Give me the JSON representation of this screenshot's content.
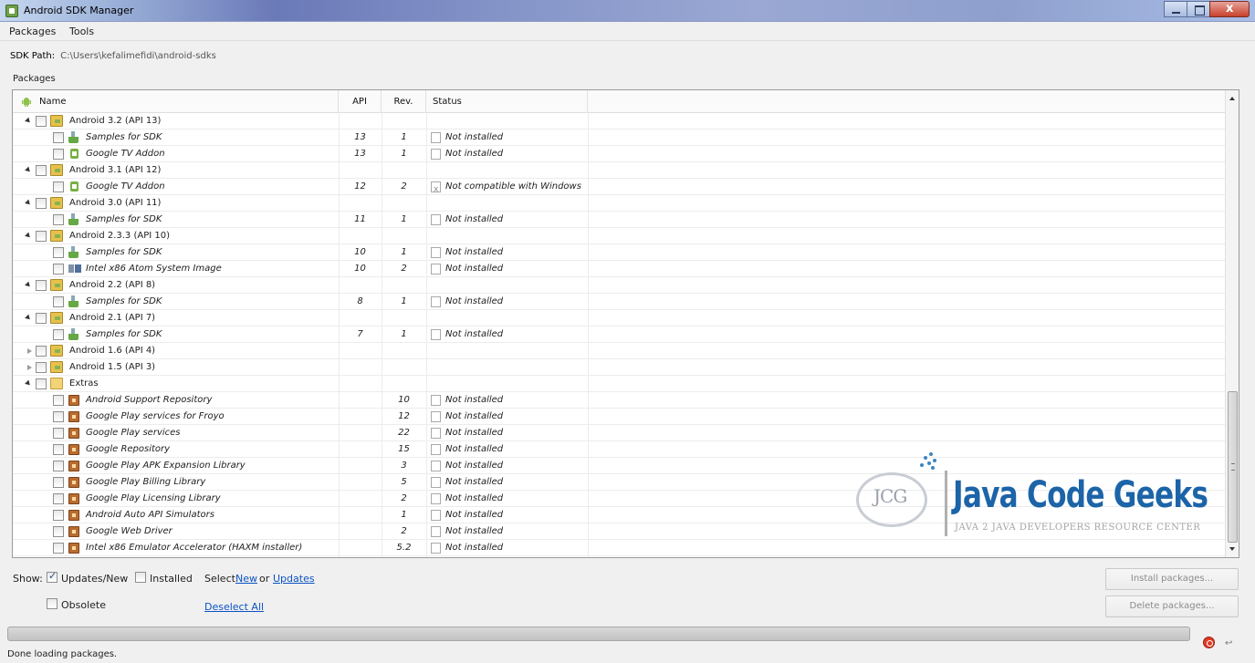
{
  "window": {
    "title": "Android SDK Manager"
  },
  "menu": [
    "Packages",
    "Tools"
  ],
  "sdk_path": {
    "label": "SDK Path:",
    "value": "C:\\Users\\kefalimefidi\\android-sdks"
  },
  "packages_label": "Packages",
  "columns": {
    "name": "Name",
    "api": "API",
    "rev": "Rev.",
    "status": "Status"
  },
  "rows": [
    {
      "level": 0,
      "expand": "open",
      "icon": "android-folder-icon",
      "name": "Android 3.2 (API 13)",
      "api": "",
      "rev": "",
      "status": ""
    },
    {
      "level": 1,
      "icon": "samples-icon",
      "name": "Samples for SDK",
      "api": "13",
      "rev": "1",
      "status": "Not installed"
    },
    {
      "level": 1,
      "icon": "addon-icon",
      "name": "Google TV Addon",
      "api": "13",
      "rev": "1",
      "status": "Not installed"
    },
    {
      "level": 0,
      "expand": "open",
      "icon": "android-folder-icon",
      "name": "Android 3.1 (API 12)",
      "api": "",
      "rev": "",
      "status": ""
    },
    {
      "level": 1,
      "icon": "addon-icon",
      "name": "Google TV Addon",
      "api": "12",
      "rev": "2",
      "status": "Not compatible with Windows",
      "incompatible": true
    },
    {
      "level": 0,
      "expand": "open",
      "icon": "android-folder-icon",
      "name": "Android 3.0 (API 11)",
      "api": "",
      "rev": "",
      "status": ""
    },
    {
      "level": 1,
      "icon": "samples-icon",
      "name": "Samples for SDK",
      "api": "11",
      "rev": "1",
      "status": "Not installed"
    },
    {
      "level": 0,
      "expand": "open",
      "icon": "android-folder-icon",
      "name": "Android 2.3.3 (API 10)",
      "api": "",
      "rev": "",
      "status": ""
    },
    {
      "level": 1,
      "icon": "samples-icon",
      "name": "Samples for SDK",
      "api": "10",
      "rev": "1",
      "status": "Not installed"
    },
    {
      "level": 1,
      "icon": "system-image-icon",
      "name": "Intel x86 Atom System Image",
      "api": "10",
      "rev": "2",
      "status": "Not installed"
    },
    {
      "level": 0,
      "expand": "open",
      "icon": "android-folder-icon",
      "name": "Android 2.2 (API 8)",
      "api": "",
      "rev": "",
      "status": ""
    },
    {
      "level": 1,
      "icon": "samples-icon",
      "name": "Samples for SDK",
      "api": "8",
      "rev": "1",
      "status": "Not installed"
    },
    {
      "level": 0,
      "expand": "open",
      "icon": "android-folder-icon",
      "name": "Android 2.1 (API 7)",
      "api": "",
      "rev": "",
      "status": ""
    },
    {
      "level": 1,
      "icon": "samples-icon",
      "name": "Samples for SDK",
      "api": "7",
      "rev": "1",
      "status": "Not installed"
    },
    {
      "level": 0,
      "expand": "closed",
      "icon": "android-folder-icon",
      "name": "Android 1.6 (API 4)",
      "api": "",
      "rev": "",
      "status": ""
    },
    {
      "level": 0,
      "expand": "closed",
      "icon": "android-folder-icon",
      "name": "Android 1.5 (API 3)",
      "api": "",
      "rev": "",
      "status": ""
    },
    {
      "level": 0,
      "expand": "open",
      "icon": "folder-icon",
      "name": "Extras",
      "api": "",
      "rev": "",
      "status": ""
    },
    {
      "level": 1,
      "icon": "package-icon",
      "name": "Android Support Repository",
      "api": "",
      "rev": "10",
      "status": "Not installed"
    },
    {
      "level": 1,
      "icon": "package-icon",
      "name": "Google Play services for Froyo",
      "api": "",
      "rev": "12",
      "status": "Not installed"
    },
    {
      "level": 1,
      "icon": "package-icon",
      "name": "Google Play services",
      "api": "",
      "rev": "22",
      "status": "Not installed"
    },
    {
      "level": 1,
      "icon": "package-icon",
      "name": "Google Repository",
      "api": "",
      "rev": "15",
      "status": "Not installed"
    },
    {
      "level": 1,
      "icon": "package-icon",
      "name": "Google Play APK Expansion Library",
      "api": "",
      "rev": "3",
      "status": "Not installed"
    },
    {
      "level": 1,
      "icon": "package-icon",
      "name": "Google Play Billing Library",
      "api": "",
      "rev": "5",
      "status": "Not installed"
    },
    {
      "level": 1,
      "icon": "package-icon",
      "name": "Google Play Licensing Library",
      "api": "",
      "rev": "2",
      "status": "Not installed"
    },
    {
      "level": 1,
      "icon": "package-icon",
      "name": "Android Auto API Simulators",
      "api": "",
      "rev": "1",
      "status": "Not installed"
    },
    {
      "level": 1,
      "icon": "package-icon",
      "name": "Google Web Driver",
      "api": "",
      "rev": "2",
      "status": "Not installed"
    },
    {
      "level": 1,
      "icon": "package-icon",
      "name": "Intel x86 Emulator Accelerator (HAXM installer)",
      "api": "",
      "rev": "5.2",
      "status": "Not installed"
    }
  ],
  "watermark": {
    "logo_text": "JCG",
    "title": "Java Code Geeks",
    "subtitle": "JAVA 2 JAVA DEVELOPERS RESOURCE CENTER"
  },
  "controls": {
    "show_label": "Show:",
    "updates_new": {
      "label": "Updates/New",
      "checked": true
    },
    "installed": {
      "label": "Installed",
      "checked": false
    },
    "select_label": "Select",
    "select_new": "New",
    "or_label": "or",
    "select_updates": "Updates",
    "obsolete": {
      "label": "Obsolete",
      "checked": false
    },
    "deselect_all": "Deselect All",
    "install_button": "Install packages...",
    "delete_button": "Delete packages..."
  },
  "status_message": "Done loading packages."
}
